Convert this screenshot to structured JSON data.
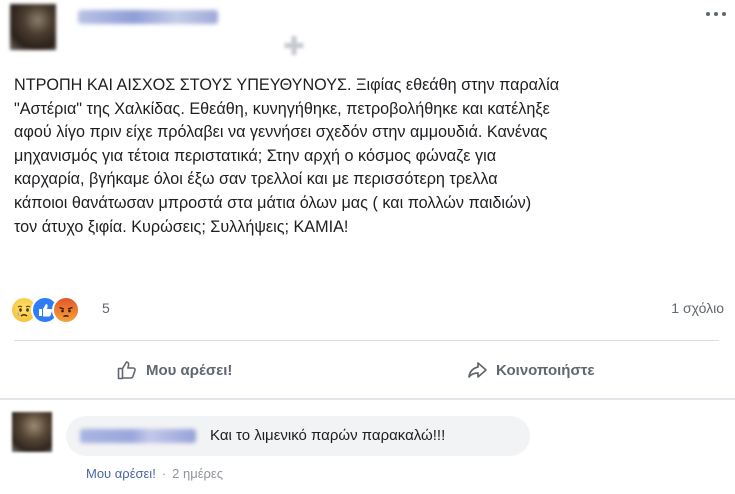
{
  "post": {
    "text": "ΝΤΡΟΠΗ ΚΑΙ ΑΙΣΧΟΣ ΣΤΟΥΣ ΥΠΕΥΘΥΝΟΥΣ. Ξιφίας εθεάθη στην παραλία\n\"Αστέρια\" της Χαλκίδας. Εθεάθη, κυνηγήθηκε, πετροβολήθηκε και κατέληξε\nαφού λίγο πριν είχε πρόλαβει να γεννήσει σχεδόν στην αμμουδιά. Κανένας\nμηχανισμός για τέτοια περιστατικά; Στην αρχή ο κόσμος φώναζε για\nκαρχαρία, βγήκαμε όλοι έξω σαν τρελλοί και με περισσότερη τρελλα\nκάποιοι θανάτωσαν μπροστά στα μάτια όλων μας ( και πολλών παιδιών)\nτον άτυχο ξιφία. Κυρώσεις; Συλλήψεις; ΚΑΜΙΑ!"
  },
  "reactions": {
    "icons": [
      "sad-reaction-icon",
      "like-reaction-icon",
      "angry-reaction-icon"
    ],
    "count": "5",
    "comments_count": "1 σχόλιο"
  },
  "actions": {
    "like_label": "Μου αρέσει!",
    "share_label": "Κοινοποιήστε"
  },
  "comment": {
    "text": "Και το λιμενικό παρών παρακαλώ!!!",
    "like_label": "Μου αρέσει!",
    "separator": "·",
    "time": "2 ημέρες"
  },
  "colors": {
    "link": "#4b67a1",
    "secondary_text": "#606770",
    "like_blue": "#2f7df6",
    "divider": "#dadde1"
  }
}
